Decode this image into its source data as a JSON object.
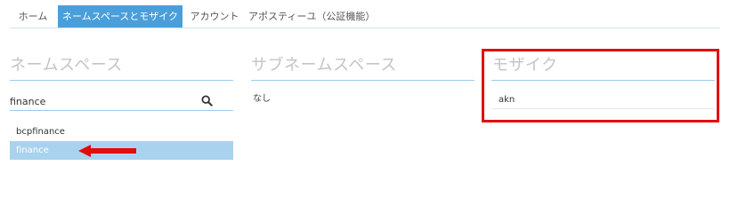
{
  "tabs": {
    "home": "ホーム",
    "namespace_mosaic": "ネームスペースとモザイク",
    "account": "アカウント",
    "apostille": "アポスティーユ（公証機能）"
  },
  "namespace": {
    "title": "ネームスペース",
    "search_value": "finance",
    "items": [
      "bcpfinance",
      "finance"
    ],
    "selected": "finance"
  },
  "subnamespace": {
    "title": "サブネームスペース",
    "empty_text": "なし"
  },
  "mosaic": {
    "title": "モザイク",
    "items": [
      "akn"
    ]
  },
  "colors": {
    "accent": "#4a9fda",
    "selected_row": "#a9d2ee",
    "highlight_red": "#e40b0b",
    "rule": "#9ccbe8"
  }
}
